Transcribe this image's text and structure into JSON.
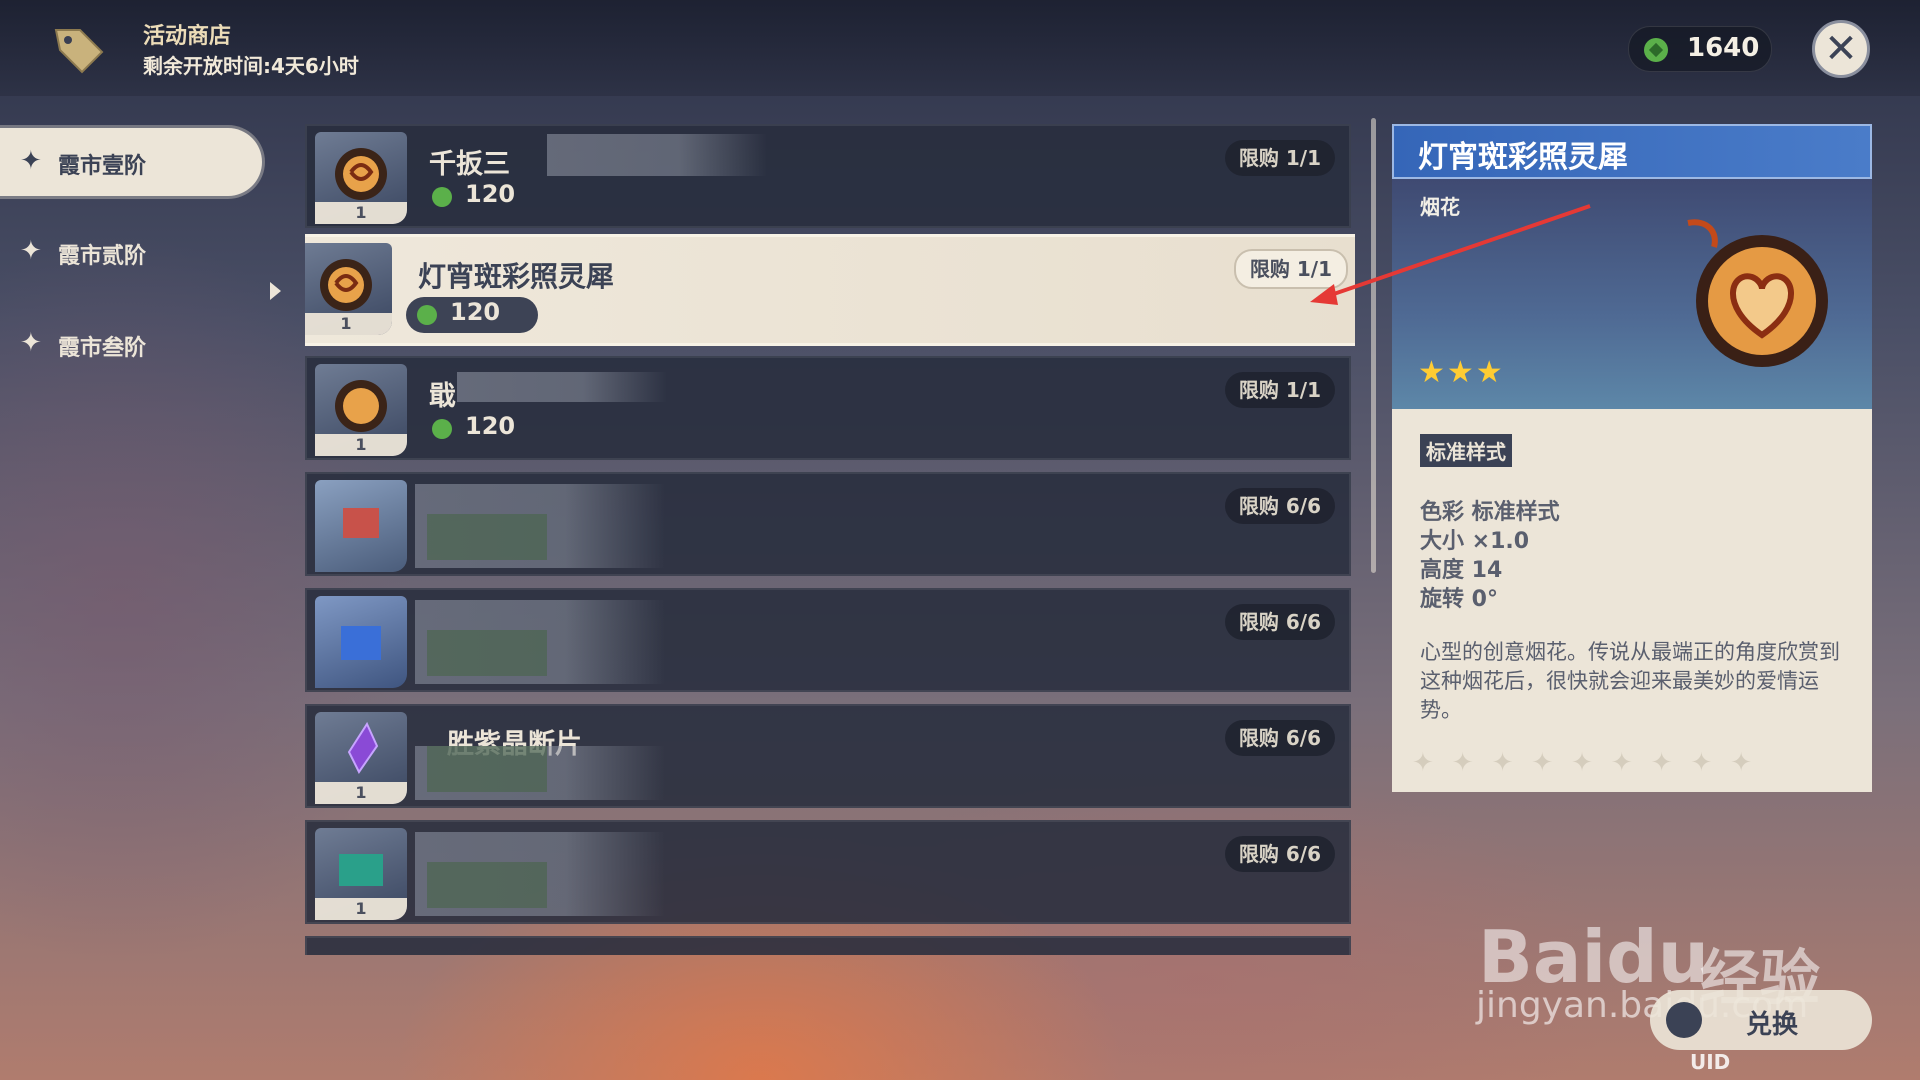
{
  "header": {
    "title": "活动商店",
    "timer": "剩余开放时间:4天6小时",
    "currency_amount": "1640"
  },
  "sidebar": {
    "items": [
      {
        "label": "霞市壹阶",
        "active": true
      },
      {
        "label": "霞市贰阶",
        "active": false
      },
      {
        "label": "霞市叁阶",
        "active": false
      }
    ]
  },
  "shop_list": {
    "rows": [
      {
        "name": "千扳三",
        "price": "120",
        "limit": "限购 1/1",
        "qty": "1"
      },
      {
        "name": "灯宵斑彩照灵犀",
        "price": "120",
        "limit": "限购 1/1",
        "qty": "1",
        "selected": true
      },
      {
        "name": "戢",
        "price": "120",
        "limit": "限购 1/1",
        "qty": "1"
      },
      {
        "name": "",
        "price": "",
        "limit": "限购 6/6",
        "qty": ""
      },
      {
        "name": "",
        "price": "",
        "limit": "限购 6/6",
        "qty": ""
      },
      {
        "name": "胜紫晶断片",
        "price": "",
        "limit": "限购 6/6",
        "qty": "1"
      },
      {
        "name": "",
        "price": "",
        "limit": "限购 6/6",
        "qty": "1"
      }
    ]
  },
  "detail": {
    "title": "灯宵斑彩照灵犀",
    "category": "烟花",
    "rarity_stars": 3,
    "style_tag": "标准样式",
    "attributes": {
      "color": "色彩 标准样式",
      "size": "大小 ×1.0",
      "height": "高度 14",
      "rotation": "旋转 0°"
    },
    "description": "心型的创意烟花。传说从最端正的角度欣赏到这种烟花后，很快就会迎来最美妙的爱情运势。"
  },
  "footer": {
    "exchange_label": "兑换",
    "uid_label": "UID"
  },
  "watermark": {
    "brand": "Bai",
    "brand_du": "du",
    "jingyan": "经验",
    "url": "jingyan.baidu.com"
  },
  "colors": {
    "panel_bg": "#ece5d8",
    "row_bg": "#2e3446",
    "title_blue": "#3566b8",
    "star_gold": "#ffcc33",
    "coin_green": "#5bb04a",
    "annotation_red": "#e53935"
  }
}
